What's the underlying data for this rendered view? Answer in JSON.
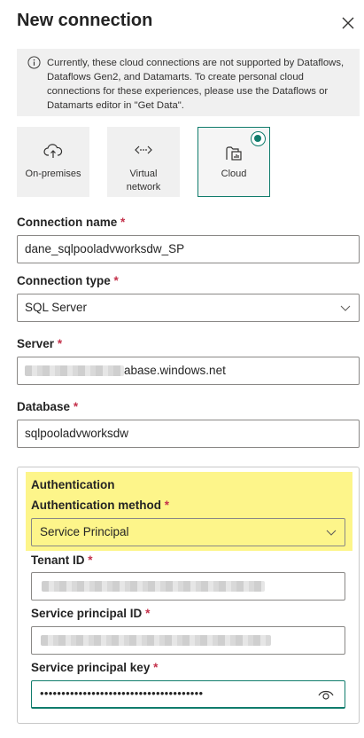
{
  "dialog": {
    "title": "New connection"
  },
  "info": {
    "message": "Currently, these cloud connections are not supported by Dataflows, Dataflows Gen2, and Datamarts. To create personal cloud connections for these experiences, please use the Dataflows or Datamarts editor in \"Get Data\"."
  },
  "connection_kinds": [
    {
      "label": "On-premises",
      "icon": "cloud-gateway-icon",
      "selected": false
    },
    {
      "label": "Virtual network",
      "icon": "virtual-network-icon",
      "selected": false
    },
    {
      "label": "Cloud",
      "icon": "cloud-report-icon",
      "selected": true
    }
  ],
  "fields": {
    "connection_name": {
      "label": "Connection name",
      "required_mark": "*",
      "value": "dane_sqlpooladvworksdw_SP"
    },
    "connection_type": {
      "label": "Connection type",
      "required_mark": "*",
      "value": "SQL Server"
    },
    "server": {
      "label": "Server",
      "required_mark": "*",
      "value_visible_suffix": "abase.windows.net"
    },
    "database": {
      "label": "Database",
      "required_mark": "*",
      "value": "sqlpooladvworksdw"
    }
  },
  "authentication": {
    "heading": "Authentication",
    "method_label": "Authentication method",
    "required_mark": "*",
    "method_value": "Service Principal",
    "tenant_id_label": "Tenant ID",
    "service_principal_id_label": "Service principal ID",
    "service_principal_key_label": "Service principal key",
    "key_masked": "••••••••••••••••••••••••••••••••••••••"
  },
  "colors": {
    "accent": "#107c6c",
    "highlight": "#fdf58a",
    "required": "#c4314b"
  }
}
